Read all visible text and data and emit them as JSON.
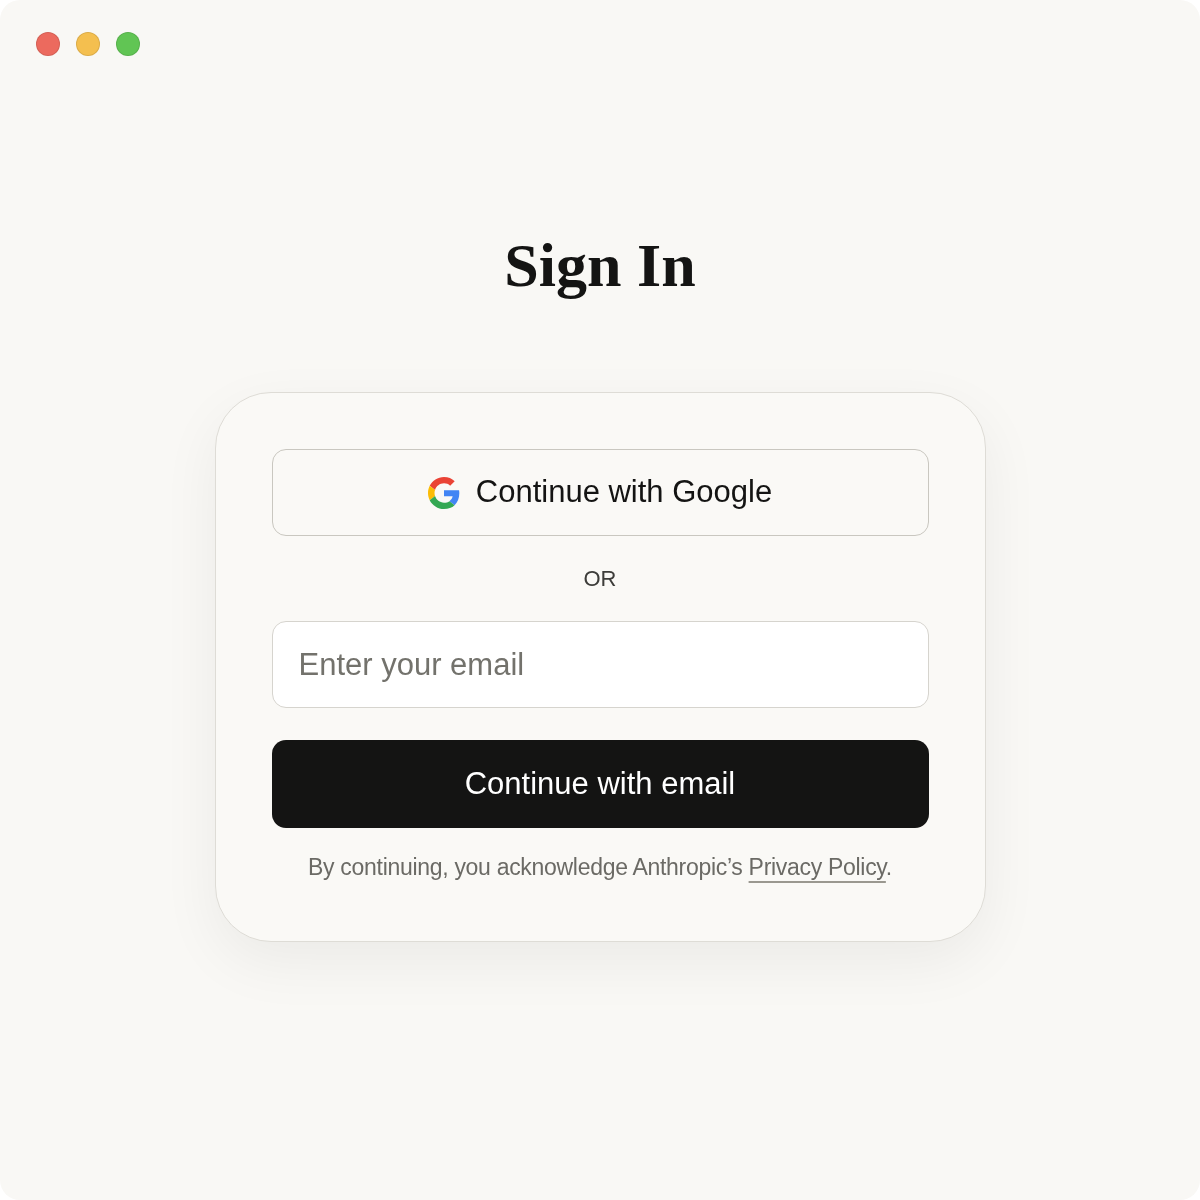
{
  "window": {
    "controls": [
      {
        "kind": "close",
        "color": "#ec6a5e"
      },
      {
        "kind": "minimize",
        "color": "#f4bf4f"
      },
      {
        "kind": "zoom",
        "color": "#61c554"
      }
    ]
  },
  "title": "Sign In",
  "google_button": {
    "label": "Continue with Google"
  },
  "divider": "OR",
  "email_field": {
    "placeholder": "Enter your email"
  },
  "email_button": {
    "label": "Continue with email"
  },
  "footer": {
    "text_before": "By continuing, you acknowledge Anthropic’s",
    "link": "Privacy Policy",
    "text_after": "."
  }
}
